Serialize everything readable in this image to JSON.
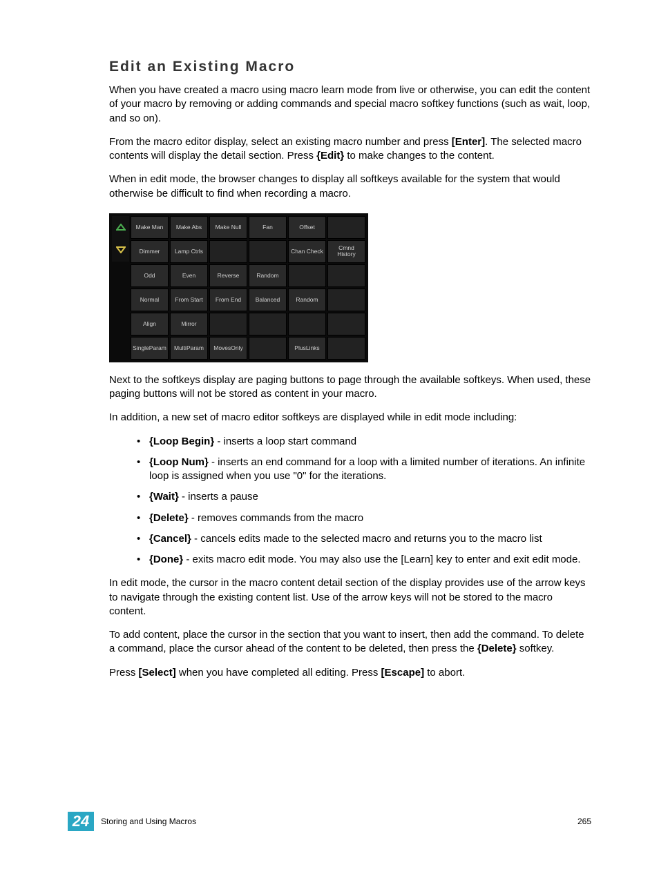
{
  "heading": "Edit an Existing Macro",
  "paragraphs": {
    "p1a": "When you have created a macro using macro learn mode from live or otherwise, you can edit the content of your macro by removing or adding commands and special macro softkey functions (such as wait, loop, and so on).",
    "p2a": "From the macro editor display, select an existing macro number and press ",
    "p2b": "[Enter]",
    "p2c": ". The selected macro contents will display the detail section. Press ",
    "p2d": "{Edit}",
    "p2e": " to make changes to the content.",
    "p3": "When in edit mode, the browser changes to display all softkeys available for the system that would otherwise be difficult to find when recording a macro.",
    "p4": "Next to the softkeys display are paging buttons to page through the available softkeys. When used, these paging buttons will not be stored as content in your macro.",
    "p5": "In addition, a new set of macro editor softkeys are displayed while in edit mode including:",
    "p6": "In edit mode, the cursor in the macro content detail section of the display provides use of the arrow keys to navigate through the existing content list. Use of the arrow keys will not be stored to the macro content.",
    "p7a": "To add content, place the cursor in the section that you want to insert, then add the command. To delete a command, place the cursor ahead of the content to be deleted, then press the ",
    "p7b": "{Delete}",
    "p7c": " softkey.",
    "p8a": "Press ",
    "p8b": "[Select]",
    "p8c": " when you have completed all editing. Press ",
    "p8d": "[Escape]",
    "p8e": " to abort."
  },
  "grid_rows": [
    [
      "Make Man",
      "Make Abs",
      "Make Null",
      "Fan",
      "Offset",
      ""
    ],
    [
      "Dimmer",
      "Lamp Ctrls",
      "",
      "",
      "Chan Check",
      "Cmnd History"
    ],
    [
      "Odd",
      "Even",
      "Reverse",
      "Random",
      "",
      ""
    ],
    [
      "Normal",
      "From Start",
      "From End",
      "Balanced",
      "Random",
      ""
    ],
    [
      "Align",
      "Mirror",
      "",
      "",
      "",
      ""
    ],
    [
      "SingleParam",
      "MultiParam",
      "MovesOnly",
      "",
      "PlusLinks",
      ""
    ]
  ],
  "list": [
    {
      "k": "{Loop Begin}",
      "d": " - inserts a loop start command"
    },
    {
      "k": "{Loop Num}",
      "d": " - inserts an end command for a loop with a limited number of iterations. An infinite loop is assigned when you use \"0\" for the iterations."
    },
    {
      "k": "{Wait}",
      "d": " - inserts a pause"
    },
    {
      "k": "{Delete}",
      "d": " - removes commands from the macro"
    },
    {
      "k": "{Cancel}",
      "d": " - cancels edits made to the selected macro and returns you to the macro list"
    },
    {
      "k": "{Done}",
      "d": " - exits macro edit mode. You may also use the [Learn] key to enter and exit edit mode."
    }
  ],
  "footer": {
    "chapter_num": "24",
    "chapter_title": "Storing and Using Macros",
    "page_num": "265"
  }
}
